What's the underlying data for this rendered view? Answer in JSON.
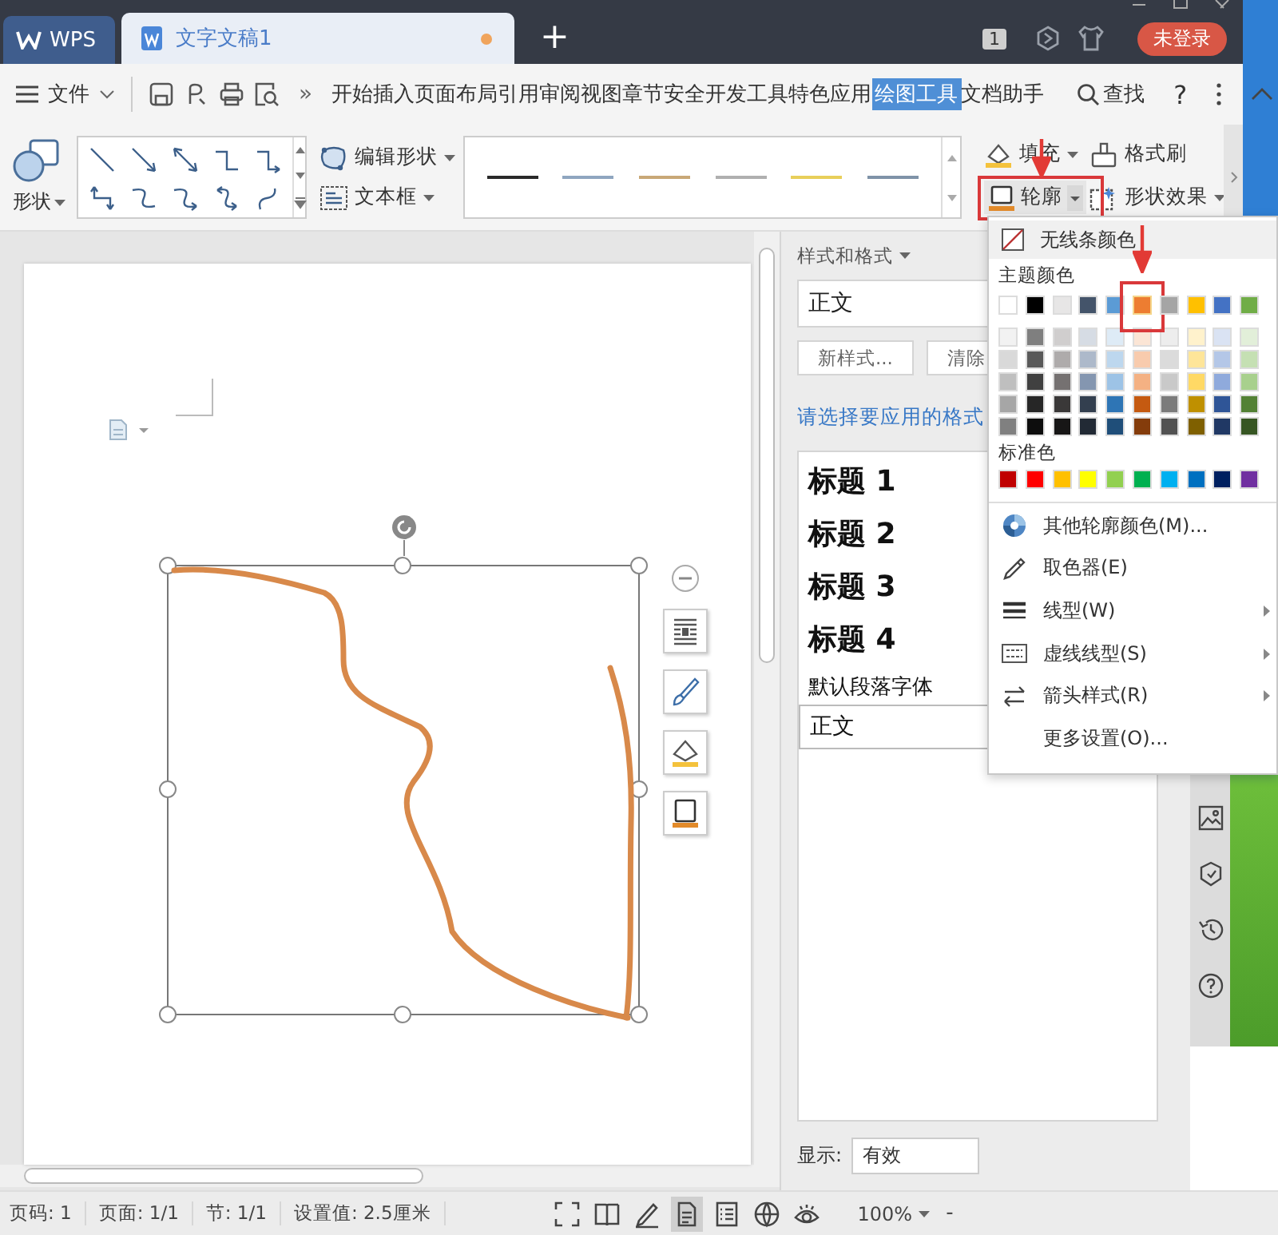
{
  "title_bar": {
    "app_tab": "WPS",
    "doc_tab": {
      "title": "文字文稿1",
      "unsaved": true
    },
    "new_tab": "+",
    "window_count": "1",
    "login": "未登录"
  },
  "menu_bar": {
    "file": "文件",
    "more": "»",
    "items": [
      {
        "label": "开始",
        "selected": false
      },
      {
        "label": "插入",
        "selected": false
      },
      {
        "label": "页面布局",
        "selected": false
      },
      {
        "label": "引用",
        "selected": false
      },
      {
        "label": "审阅",
        "selected": false
      },
      {
        "label": "视图",
        "selected": false
      },
      {
        "label": "章节",
        "selected": false
      },
      {
        "label": "安全",
        "selected": false
      },
      {
        "label": "开发工具",
        "selected": false
      },
      {
        "label": "特色应用",
        "selected": false
      },
      {
        "label": "绘图工具",
        "selected": true
      },
      {
        "label": "文档助手",
        "selected": false
      }
    ],
    "find": "查找",
    "help": "?"
  },
  "ribbon": {
    "shape_label": "形状",
    "edit_shape": "编辑形状",
    "text_box": "文本框",
    "line_styles": [
      {
        "color": "#2a2a2a"
      },
      {
        "color": "#8fa6c0"
      },
      {
        "color": "#c8a877"
      },
      {
        "color": "#b0b0b0"
      },
      {
        "color": "#e8cf5a"
      },
      {
        "color": "#7f93a8"
      }
    ],
    "fill": "填充",
    "format_painter": "格式刷",
    "outline": {
      "label": "轮廓",
      "highlighted": true
    },
    "shape_effects": "形状效果"
  },
  "styles_panel": {
    "title": "样式和格式",
    "current_style": "正文",
    "new_style": "新样式...",
    "clear": "清除",
    "prompt": "请选择要应用的格式",
    "styles": [
      {
        "label": "标题 1",
        "kind": "heading"
      },
      {
        "label": "标题 2",
        "kind": "heading"
      },
      {
        "label": "标题 3",
        "kind": "heading"
      },
      {
        "label": "标题 4",
        "kind": "heading"
      },
      {
        "label": "默认段落字体",
        "kind": "plain"
      },
      {
        "label": "正文",
        "kind": "boxed"
      }
    ],
    "show_label": "显示:",
    "show_value": "有效"
  },
  "outline_menu": {
    "no_line": "无线条颜色",
    "theme_label": "主题颜色",
    "theme_colors": [
      {
        "color": "#ffffff",
        "selected": false,
        "shades": [
          {
            "color": "#f2f2f2"
          },
          {
            "color": "#d9d9d9"
          },
          {
            "color": "#bfbfbf"
          },
          {
            "color": "#a6a6a6"
          },
          {
            "color": "#808080"
          }
        ]
      },
      {
        "color": "#000000",
        "selected": false,
        "shades": [
          {
            "color": "#7f7f7f"
          },
          {
            "color": "#595959"
          },
          {
            "color": "#404040"
          },
          {
            "color": "#262626"
          },
          {
            "color": "#0d0d0d"
          }
        ]
      },
      {
        "color": "#e7e6e6",
        "selected": false,
        "shades": [
          {
            "color": "#d0cece"
          },
          {
            "color": "#aeabab"
          },
          {
            "color": "#757171"
          },
          {
            "color": "#3a3838"
          },
          {
            "color": "#171616"
          }
        ]
      },
      {
        "color": "#44546a",
        "selected": false,
        "shades": [
          {
            "color": "#d6dce4"
          },
          {
            "color": "#adb9ca"
          },
          {
            "color": "#8496b0"
          },
          {
            "color": "#333f4f"
          },
          {
            "color": "#222a35"
          }
        ]
      },
      {
        "color": "#5b9bd5",
        "selected": false,
        "shades": [
          {
            "color": "#deebf6"
          },
          {
            "color": "#bdd7ee"
          },
          {
            "color": "#9dc3e6"
          },
          {
            "color": "#2e75b5"
          },
          {
            "color": "#1f4e79"
          }
        ]
      },
      {
        "color": "#ed7d31",
        "selected": true,
        "shades": [
          {
            "color": "#fbe5d5"
          },
          {
            "color": "#f8cbad"
          },
          {
            "color": "#f4b183"
          },
          {
            "color": "#c55a11"
          },
          {
            "color": "#843c0b"
          }
        ]
      },
      {
        "color": "#a5a5a5",
        "selected": false,
        "shades": [
          {
            "color": "#ededed"
          },
          {
            "color": "#dbdbdb"
          },
          {
            "color": "#c9c9c9"
          },
          {
            "color": "#7b7b7b"
          },
          {
            "color": "#525252"
          }
        ]
      },
      {
        "color": "#ffc000",
        "selected": false,
        "shades": [
          {
            "color": "#fff2cc"
          },
          {
            "color": "#fee599"
          },
          {
            "color": "#ffd965"
          },
          {
            "color": "#bf9000"
          },
          {
            "color": "#7f6000"
          }
        ]
      },
      {
        "color": "#4472c4",
        "selected": false,
        "shades": [
          {
            "color": "#dae3f3"
          },
          {
            "color": "#b4c7e7"
          },
          {
            "color": "#8faadc"
          },
          {
            "color": "#2f5597"
          },
          {
            "color": "#203864"
          }
        ]
      },
      {
        "color": "#70ad47",
        "selected": false,
        "shades": [
          {
            "color": "#e2efd9"
          },
          {
            "color": "#c5e0b3"
          },
          {
            "color": "#a8d08d"
          },
          {
            "color": "#538135"
          },
          {
            "color": "#375623"
          }
        ]
      }
    ],
    "standard_label": "标准色",
    "standard_colors": [
      {
        "color": "#c00000"
      },
      {
        "color": "#ff0000"
      },
      {
        "color": "#ffc000"
      },
      {
        "color": "#ffff00"
      },
      {
        "color": "#92d050"
      },
      {
        "color": "#00b050"
      },
      {
        "color": "#00b0f0"
      },
      {
        "color": "#0070c0"
      },
      {
        "color": "#002060"
      },
      {
        "color": "#7030a0"
      }
    ],
    "items": [
      {
        "label": "其他轮廓颜色(M)...",
        "kind": "more_colors",
        "submenu": false
      },
      {
        "label": "取色器(E)",
        "kind": "eyedropper",
        "submenu": false
      },
      {
        "label": "线型(W)",
        "kind": "line_type",
        "submenu": true
      },
      {
        "label": "虚线线型(S)",
        "kind": "dash_type",
        "submenu": true
      },
      {
        "label": "箭头样式(R)",
        "kind": "arrow_style",
        "submenu": true
      },
      {
        "label": "更多设置(O)...",
        "kind": "settings",
        "submenu": false
      }
    ]
  },
  "status_bar": {
    "items": [
      "页码: 1",
      "页面: 1/1",
      "节: 1/1",
      "设置值: 2.5厘米"
    ],
    "view_modes": [
      {
        "kind": "fullscreen",
        "selected": false
      },
      {
        "kind": "reading",
        "selected": false
      },
      {
        "kind": "edit",
        "selected": false
      },
      {
        "kind": "page",
        "selected": true
      },
      {
        "kind": "outline",
        "selected": false
      },
      {
        "kind": "web",
        "selected": false
      },
      {
        "kind": "eye",
        "selected": false
      }
    ],
    "zoom": "100%",
    "zoom_out": "-"
  }
}
